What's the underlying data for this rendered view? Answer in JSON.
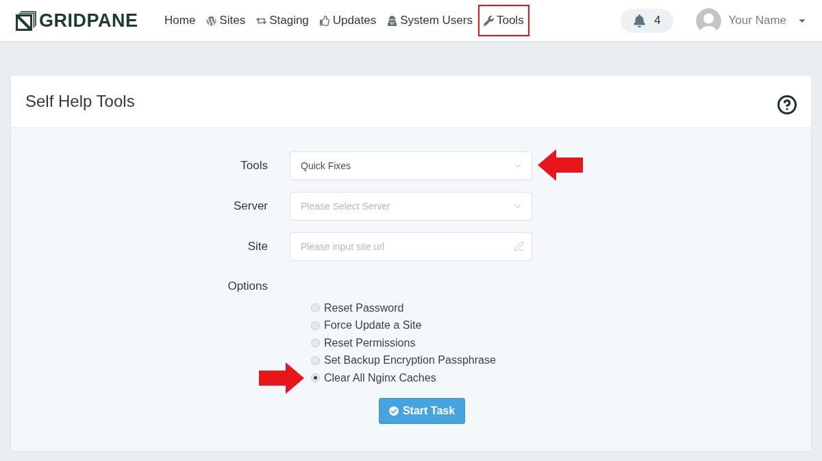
{
  "navbar": {
    "logo": "GRIDPANE",
    "items": [
      {
        "label": "Home",
        "highlighted": false
      },
      {
        "label": "Sites",
        "highlighted": false
      },
      {
        "label": "Staging",
        "highlighted": false
      },
      {
        "label": "Updates",
        "highlighted": false
      },
      {
        "label": "System Users",
        "highlighted": false
      },
      {
        "label": "Tools",
        "highlighted": true
      }
    ],
    "notifications": {
      "count": "4"
    },
    "user": {
      "name": "Your Name"
    }
  },
  "card": {
    "title": "Self Help Tools",
    "fields": [
      {
        "kind": "select",
        "label": "Tools",
        "value": "Quick Fixes",
        "pointer_arrow": true
      },
      {
        "kind": "select",
        "label": "Server",
        "placeholder": "Please Select Server",
        "pointer_arrow": false
      },
      {
        "kind": "text",
        "label": "Site",
        "placeholder": "Please input site url",
        "pointer_arrow": false
      }
    ],
    "options": {
      "label": "Options",
      "items": [
        {
          "label": "Reset Password",
          "selected": false,
          "pointer_arrow": false
        },
        {
          "label": "Force Update a Site",
          "selected": false,
          "pointer_arrow": false
        },
        {
          "label": "Reset Permissions",
          "selected": false,
          "pointer_arrow": false
        },
        {
          "label": "Set Backup Encryption Passphrase",
          "selected": false,
          "pointer_arrow": false
        },
        {
          "label": "Clear All Nginx Caches",
          "selected": true,
          "pointer_arrow": true
        }
      ]
    },
    "submit": "Start Task"
  }
}
